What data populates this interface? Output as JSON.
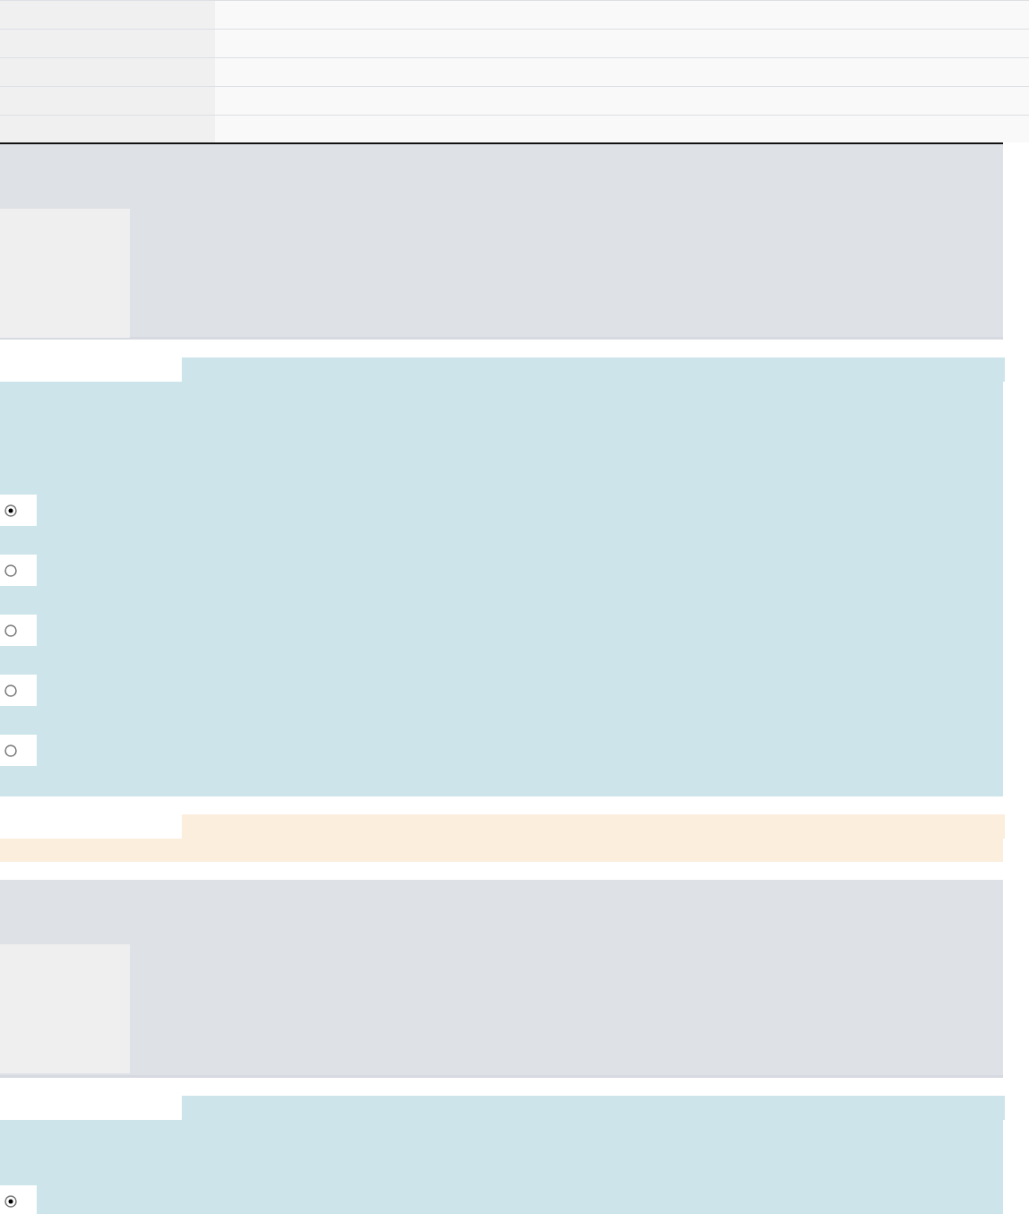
{
  "radio_groups": [
    {
      "options": [
        {
          "selected": true
        },
        {
          "selected": false
        },
        {
          "selected": false
        },
        {
          "selected": false
        },
        {
          "selected": false
        }
      ]
    },
    {
      "options": [
        {
          "selected": true
        }
      ]
    }
  ]
}
